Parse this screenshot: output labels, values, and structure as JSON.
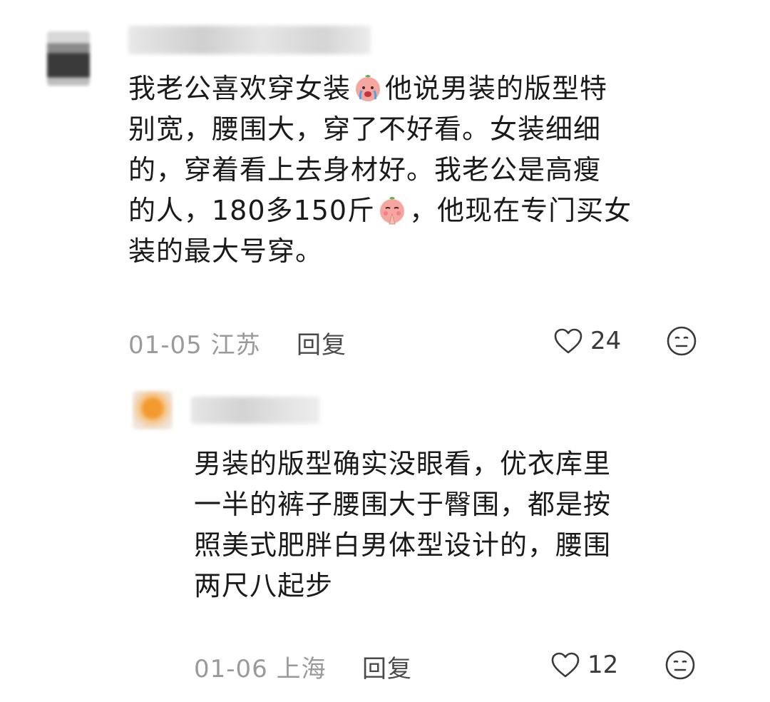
{
  "comments": [
    {
      "text_lines": [
        [
          "我老公喜欢穿女装",
          "他说男装的版型特"
        ],
        [
          "别宽，腰围大，穿了不好看。女装细细"
        ],
        [
          "的，穿着看上去身材好。我老公是高瘦"
        ],
        [
          "的人，180多150斤",
          "，他现在专门买女"
        ],
        [
          "装的最大号穿。"
        ]
      ],
      "emojis": [
        "crying-emoji",
        "praying-emoji"
      ],
      "date": "01-05",
      "location": "江苏",
      "reply_label": "回复",
      "likes": "24"
    },
    {
      "text_lines": [
        [
          "男装的版型确实没眼看，优衣库里"
        ],
        [
          "一半的裤子腰围大于臀围，都是按"
        ],
        [
          "照美式肥胖白男体型设计的，腰围"
        ],
        [
          "两尺八起步"
        ]
      ],
      "date": "01-06",
      "location": "上海",
      "reply_label": "回复",
      "likes": "12"
    }
  ],
  "icons": {
    "like": "heart-outline-icon",
    "react": "neutral-face-icon"
  },
  "colors": {
    "meta_gray": "#9a9a9a",
    "reply_text": "#4a4a4a",
    "text": "#1a1a1a"
  }
}
